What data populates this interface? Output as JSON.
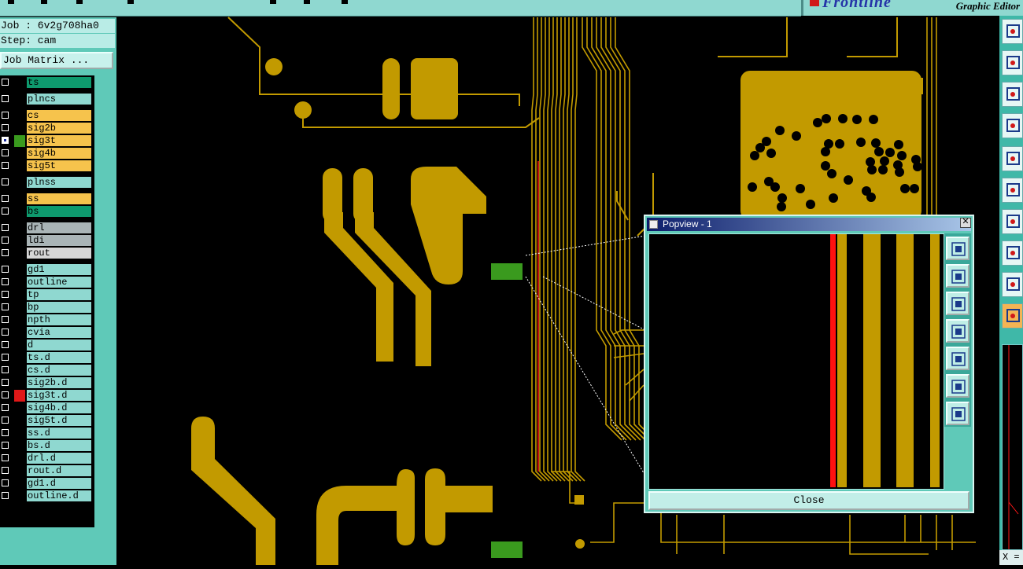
{
  "app": {
    "brand": "Frontline",
    "title": "Graphic Editor"
  },
  "job": {
    "job_line": "Job : 6v2g708ha0",
    "step_line": "Step: cam",
    "matrix_button": "Job Matrix ..."
  },
  "layers": [
    {
      "name": "ts",
      "color": "#0e9a6e",
      "checked": false,
      "swatch": ""
    },
    {
      "name": "plncs",
      "color": "#8fd8d0",
      "checked": false,
      "swatch": ""
    },
    {
      "name": "cs",
      "color": "#f6c34c",
      "checked": false,
      "swatch": ""
    },
    {
      "name": "sig2b",
      "color": "#f6c34c",
      "checked": false,
      "swatch": ""
    },
    {
      "name": "sig3t",
      "color": "#f6c34c",
      "checked": true,
      "swatch": "#3a9a1e",
      "marker": true
    },
    {
      "name": "sig4b",
      "color": "#f6c34c",
      "checked": false,
      "swatch": ""
    },
    {
      "name": "sig5t",
      "color": "#f6c34c",
      "checked": false,
      "swatch": ""
    },
    {
      "name": "plnss",
      "color": "#8fd8d0",
      "checked": false,
      "swatch": ""
    },
    {
      "name": "ss",
      "color": "#f6c34c",
      "checked": false,
      "swatch": ""
    },
    {
      "name": "bs",
      "color": "#0e9a6e",
      "checked": false,
      "swatch": ""
    },
    {
      "name": "drl",
      "color": "#a9b4b6",
      "checked": false,
      "swatch": ""
    },
    {
      "name": "ldi",
      "color": "#a9b4b6",
      "checked": false,
      "swatch": ""
    },
    {
      "name": "rout",
      "color": "#d6d6d6",
      "checked": false,
      "swatch": ""
    },
    {
      "name": "gd1",
      "color": "#8fd8d0",
      "checked": false,
      "swatch": ""
    },
    {
      "name": "outline",
      "color": "#8fd8d0",
      "checked": false,
      "swatch": ""
    },
    {
      "name": "tp",
      "color": "#8fd8d0",
      "checked": false,
      "swatch": ""
    },
    {
      "name": "bp",
      "color": "#8fd8d0",
      "checked": false,
      "swatch": ""
    },
    {
      "name": "npth",
      "color": "#8fd8d0",
      "checked": false,
      "swatch": ""
    },
    {
      "name": "cvia",
      "color": "#8fd8d0",
      "checked": false,
      "swatch": ""
    },
    {
      "name": "d",
      "color": "#8fd8d0",
      "checked": false,
      "swatch": ""
    },
    {
      "name": "ts.d",
      "color": "#8fd8d0",
      "checked": false,
      "swatch": ""
    },
    {
      "name": "cs.d",
      "color": "#8fd8d0",
      "checked": false,
      "swatch": ""
    },
    {
      "name": "sig2b.d",
      "color": "#8fd8d0",
      "checked": false,
      "swatch": ""
    },
    {
      "name": "sig3t.d",
      "color": "#8fd8d0",
      "checked": false,
      "swatch": "#e01818"
    },
    {
      "name": "sig4b.d",
      "color": "#8fd8d0",
      "checked": false,
      "swatch": ""
    },
    {
      "name": "sig5t.d",
      "color": "#8fd8d0",
      "checked": false,
      "swatch": ""
    },
    {
      "name": "ss.d",
      "color": "#8fd8d0",
      "checked": false,
      "swatch": ""
    },
    {
      "name": "bs.d",
      "color": "#8fd8d0",
      "checked": false,
      "swatch": ""
    },
    {
      "name": "drl.d",
      "color": "#8fd8d0",
      "checked": false,
      "swatch": ""
    },
    {
      "name": "rout.d",
      "color": "#8fd8d0",
      "checked": false,
      "swatch": ""
    },
    {
      "name": "gd1.d",
      "color": "#8fd8d0",
      "checked": false,
      "swatch": ""
    },
    {
      "name": "outline.d",
      "color": "#8fd8d0",
      "checked": false,
      "swatch": ""
    }
  ],
  "popview": {
    "title": "Popview - 1",
    "close_label": "Close",
    "tools": [
      "zoom-fit-icon",
      "pan-up-icon",
      "pan-down-icon",
      "pan-left-icon",
      "pan-right-icon",
      "zoom-in-icon",
      "zoom-out-icon"
    ]
  },
  "right_tools": [
    "open-icon",
    "window-icon",
    "select-icon",
    "measure-icon",
    "pad-icon",
    "net-icon",
    "triangle-icon",
    "snap-icon",
    "warning-icon",
    "pointer-icon"
  ],
  "coord": {
    "label": "X ="
  },
  "colors": {
    "copper": "#c29a00",
    "mask": "#3a9a1e",
    "highlight": "#ff1010",
    "panel": "#5fc9b8",
    "titlebar": "#0c1d6b"
  }
}
